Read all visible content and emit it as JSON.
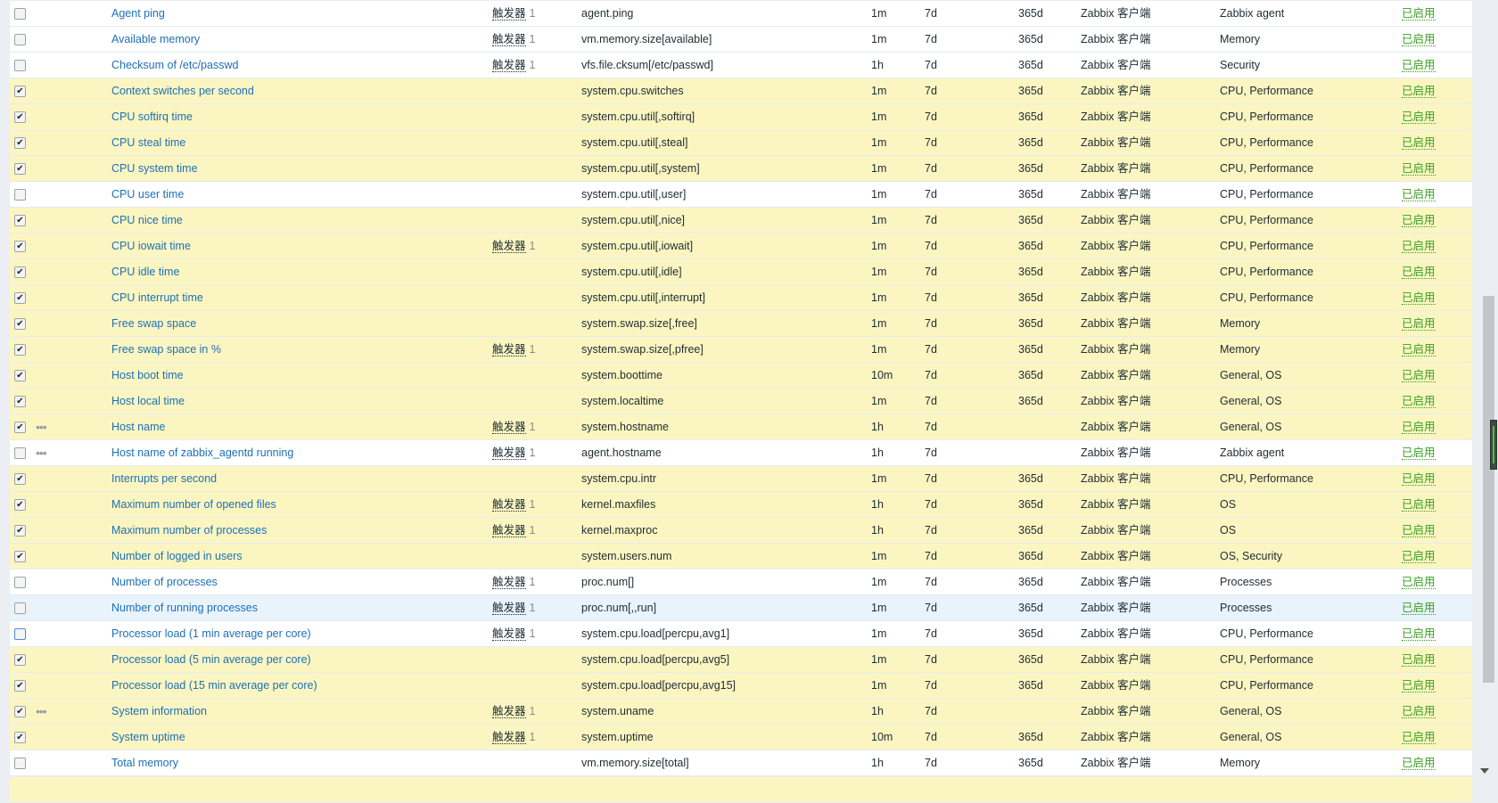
{
  "trigger_label": "触发器",
  "status_label": "已启用",
  "colors": {
    "selected_row": "#fbf6c1",
    "link": "#1d6fb8",
    "enabled": "#3a9d23",
    "hover_row": "#e8f3fc"
  },
  "rows": [
    {
      "c": false,
      "d": false,
      "name": "Agent ping",
      "t": "1",
      "key": "agent.ping",
      "i": "1m",
      "h": "7d",
      "tr": "365d",
      "type": "Zabbix 客户端",
      "app": "Zabbix agent"
    },
    {
      "c": false,
      "d": false,
      "name": "Available memory",
      "t": "1",
      "key": "vm.memory.size[available]",
      "i": "1m",
      "h": "7d",
      "tr": "365d",
      "type": "Zabbix 客户端",
      "app": "Memory"
    },
    {
      "c": false,
      "d": false,
      "name": "Checksum of /etc/passwd",
      "t": "1",
      "key": "vfs.file.cksum[/etc/passwd]",
      "i": "1h",
      "h": "7d",
      "tr": "365d",
      "type": "Zabbix 客户端",
      "app": "Security"
    },
    {
      "c": true,
      "d": false,
      "name": "Context switches per second",
      "t": "",
      "key": "system.cpu.switches",
      "i": "1m",
      "h": "7d",
      "tr": "365d",
      "type": "Zabbix 客户端",
      "app": "CPU, Performance"
    },
    {
      "c": true,
      "d": false,
      "name": "CPU softirq time",
      "t": "",
      "key": "system.cpu.util[,softirq]",
      "i": "1m",
      "h": "7d",
      "tr": "365d",
      "type": "Zabbix 客户端",
      "app": "CPU, Performance"
    },
    {
      "c": true,
      "d": false,
      "name": "CPU steal time",
      "t": "",
      "key": "system.cpu.util[,steal]",
      "i": "1m",
      "h": "7d",
      "tr": "365d",
      "type": "Zabbix 客户端",
      "app": "CPU, Performance"
    },
    {
      "c": true,
      "d": false,
      "name": "CPU system time",
      "t": "",
      "key": "system.cpu.util[,system]",
      "i": "1m",
      "h": "7d",
      "tr": "365d",
      "type": "Zabbix 客户端",
      "app": "CPU, Performance"
    },
    {
      "c": false,
      "d": false,
      "name": "CPU user time",
      "t": "",
      "key": "system.cpu.util[,user]",
      "i": "1m",
      "h": "7d",
      "tr": "365d",
      "type": "Zabbix 客户端",
      "app": "CPU, Performance"
    },
    {
      "c": true,
      "d": false,
      "name": "CPU nice time",
      "t": "",
      "key": "system.cpu.util[,nice]",
      "i": "1m",
      "h": "7d",
      "tr": "365d",
      "type": "Zabbix 客户端",
      "app": "CPU, Performance"
    },
    {
      "c": true,
      "d": false,
      "name": "CPU iowait time",
      "t": "1",
      "key": "system.cpu.util[,iowait]",
      "i": "1m",
      "h": "7d",
      "tr": "365d",
      "type": "Zabbix 客户端",
      "app": "CPU, Performance"
    },
    {
      "c": true,
      "d": false,
      "name": "CPU idle time",
      "t": "",
      "key": "system.cpu.util[,idle]",
      "i": "1m",
      "h": "7d",
      "tr": "365d",
      "type": "Zabbix 客户端",
      "app": "CPU, Performance"
    },
    {
      "c": true,
      "d": false,
      "name": "CPU interrupt time",
      "t": "",
      "key": "system.cpu.util[,interrupt]",
      "i": "1m",
      "h": "7d",
      "tr": "365d",
      "type": "Zabbix 客户端",
      "app": "CPU, Performance"
    },
    {
      "c": true,
      "d": false,
      "name": "Free swap space",
      "t": "",
      "key": "system.swap.size[,free]",
      "i": "1m",
      "h": "7d",
      "tr": "365d",
      "type": "Zabbix 客户端",
      "app": "Memory"
    },
    {
      "c": true,
      "d": false,
      "name": "Free swap space in %",
      "t": "1",
      "key": "system.swap.size[,pfree]",
      "i": "1m",
      "h": "7d",
      "tr": "365d",
      "type": "Zabbix 客户端",
      "app": "Memory"
    },
    {
      "c": true,
      "d": false,
      "name": "Host boot time",
      "t": "",
      "key": "system.boottime",
      "i": "10m",
      "h": "7d",
      "tr": "365d",
      "type": "Zabbix 客户端",
      "app": "General, OS"
    },
    {
      "c": true,
      "d": false,
      "name": "Host local time",
      "t": "",
      "key": "system.localtime",
      "i": "1m",
      "h": "7d",
      "tr": "365d",
      "type": "Zabbix 客户端",
      "app": "General, OS"
    },
    {
      "c": true,
      "d": true,
      "name": "Host name",
      "t": "1",
      "key": "system.hostname",
      "i": "1h",
      "h": "7d",
      "tr": "",
      "type": "Zabbix 客户端",
      "app": "General, OS"
    },
    {
      "c": false,
      "d": true,
      "name": "Host name of zabbix_agentd running",
      "t": "1",
      "key": "agent.hostname",
      "i": "1h",
      "h": "7d",
      "tr": "",
      "type": "Zabbix 客户端",
      "app": "Zabbix agent"
    },
    {
      "c": true,
      "d": false,
      "name": "Interrupts per second",
      "t": "",
      "key": "system.cpu.intr",
      "i": "1m",
      "h": "7d",
      "tr": "365d",
      "type": "Zabbix 客户端",
      "app": "CPU, Performance"
    },
    {
      "c": true,
      "d": false,
      "name": "Maximum number of opened files",
      "t": "1",
      "key": "kernel.maxfiles",
      "i": "1h",
      "h": "7d",
      "tr": "365d",
      "type": "Zabbix 客户端",
      "app": "OS"
    },
    {
      "c": true,
      "d": false,
      "name": "Maximum number of processes",
      "t": "1",
      "key": "kernel.maxproc",
      "i": "1h",
      "h": "7d",
      "tr": "365d",
      "type": "Zabbix 客户端",
      "app": "OS"
    },
    {
      "c": true,
      "d": false,
      "name": "Number of logged in users",
      "t": "",
      "key": "system.users.num",
      "i": "1m",
      "h": "7d",
      "tr": "365d",
      "type": "Zabbix 客户端",
      "app": "OS, Security"
    },
    {
      "c": false,
      "d": false,
      "name": "Number of processes",
      "t": "1",
      "key": "proc.num[]",
      "i": "1m",
      "h": "7d",
      "tr": "365d",
      "type": "Zabbix 客户端",
      "app": "Processes"
    },
    {
      "c": false,
      "d": false,
      "hover": true,
      "name": "Number of running processes",
      "t": "1",
      "key": "proc.num[,,run]",
      "i": "1m",
      "h": "7d",
      "tr": "365d",
      "type": "Zabbix 客户端",
      "app": "Processes"
    },
    {
      "c": false,
      "d": false,
      "focus": true,
      "name": "Processor load (1 min average per core)",
      "t": "1",
      "key": "system.cpu.load[percpu,avg1]",
      "i": "1m",
      "h": "7d",
      "tr": "365d",
      "type": "Zabbix 客户端",
      "app": "CPU, Performance"
    },
    {
      "c": true,
      "d": false,
      "name": "Processor load (5 min average per core)",
      "t": "",
      "key": "system.cpu.load[percpu,avg5]",
      "i": "1m",
      "h": "7d",
      "tr": "365d",
      "type": "Zabbix 客户端",
      "app": "CPU, Performance"
    },
    {
      "c": true,
      "d": false,
      "name": "Processor load (15 min average per core)",
      "t": "",
      "key": "system.cpu.load[percpu,avg15]",
      "i": "1m",
      "h": "7d",
      "tr": "365d",
      "type": "Zabbix 客户端",
      "app": "CPU, Performance"
    },
    {
      "c": true,
      "d": true,
      "name": "System information",
      "t": "1",
      "key": "system.uname",
      "i": "1h",
      "h": "7d",
      "tr": "",
      "type": "Zabbix 客户端",
      "app": "General, OS"
    },
    {
      "c": true,
      "d": false,
      "name": "System uptime",
      "t": "1",
      "key": "system.uptime",
      "i": "10m",
      "h": "7d",
      "tr": "365d",
      "type": "Zabbix 客户端",
      "app": "General, OS"
    },
    {
      "c": false,
      "d": false,
      "name": "Total memory",
      "t": "",
      "key": "vm.memory.size[total]",
      "i": "1h",
      "h": "7d",
      "tr": "365d",
      "type": "Zabbix 客户端",
      "app": "Memory"
    }
  ]
}
